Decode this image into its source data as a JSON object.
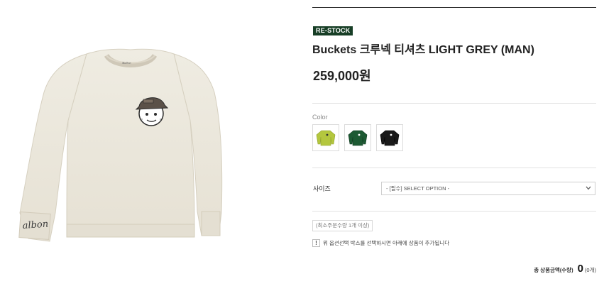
{
  "product": {
    "badge": "RE-STOCK",
    "title": "Buckets 크루넥 티셔츠 LIGHT GREY (MAN)",
    "price": "259,000원",
    "image_sleeve_text": "albon",
    "image_collar_text": "Malbon"
  },
  "color_section": {
    "label": "Color",
    "swatches": [
      {
        "name": "lime",
        "color": "#b4c73e"
      },
      {
        "name": "green",
        "color": "#1d5a33"
      },
      {
        "name": "black",
        "color": "#1a1a1a"
      }
    ]
  },
  "size_section": {
    "label": "사이즈",
    "select_value": "- [필수] SELECT OPTION -"
  },
  "min_order_text": "(최소주문수량 1개 이상)",
  "notice": {
    "icon": "!",
    "text": "위 옵션선택 박스를 선택하시면 아래에 상품이 추가됩니다"
  },
  "total": {
    "label": "총 상품금액(수량)",
    "amount": "0",
    "count": "(0개)"
  },
  "colors": {
    "badge_bg": "#173e26",
    "sweatshirt": "#ebe7dc"
  }
}
